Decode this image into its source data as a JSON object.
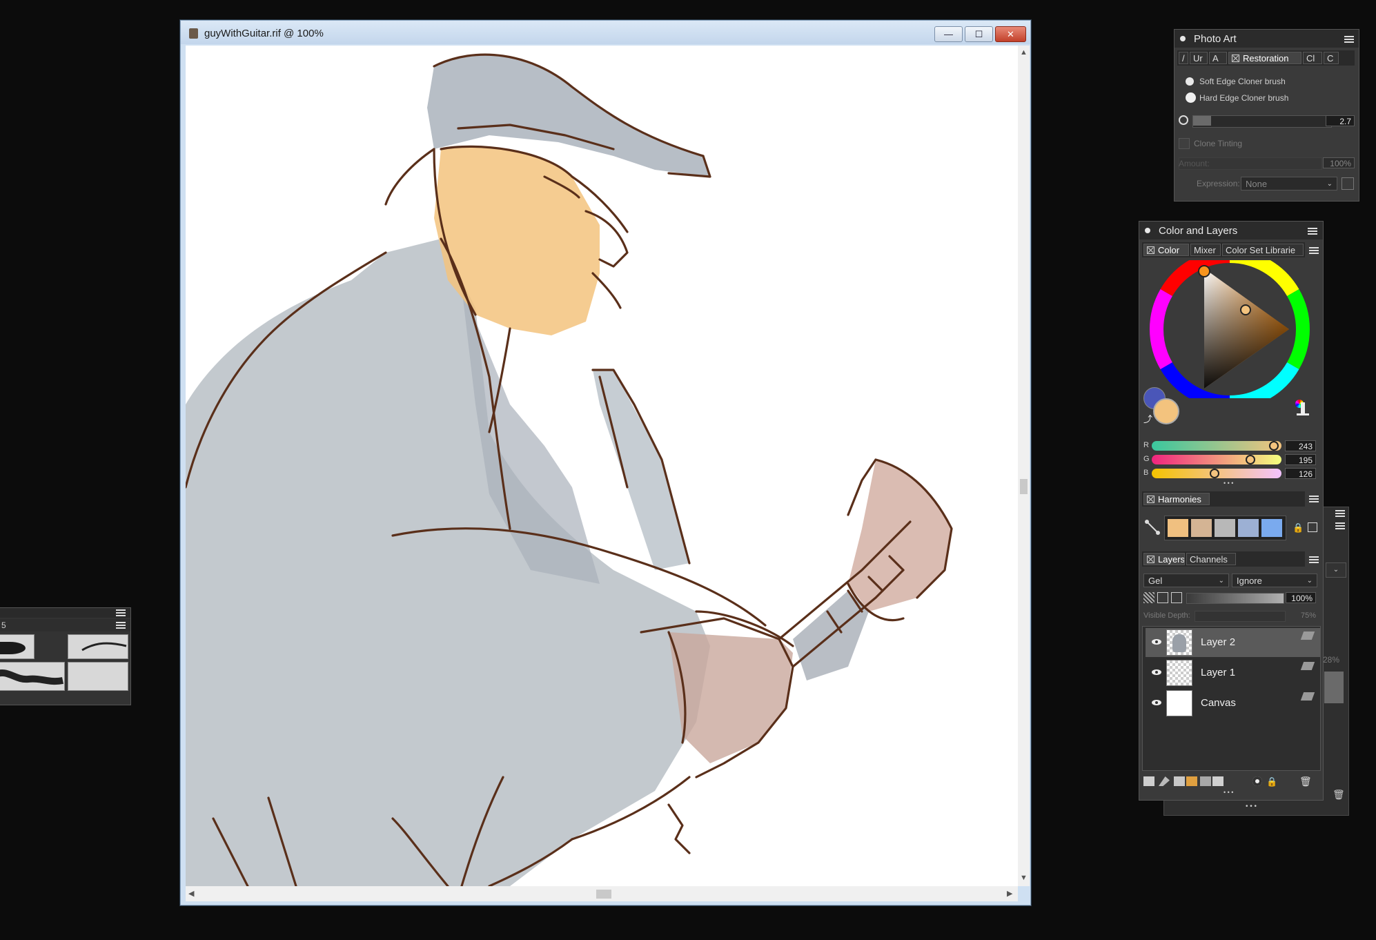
{
  "document": {
    "title": "guyWithGuitar.rif @ 100%",
    "minimize": "—",
    "maximize": "☐",
    "close": "✕"
  },
  "photo_art": {
    "title": "Photo Art",
    "tabs": [
      "/",
      "Ur",
      "A",
      "Restoration",
      "Cl",
      "C"
    ],
    "brushes": [
      "Soft Edge Cloner brush",
      "Hard Edge Cloner brush"
    ],
    "size_value": "2.7",
    "clone_tinting_label": "Clone Tinting",
    "amount_label": "Amount:",
    "amount_value": "100%",
    "expression_label": "Expression:",
    "expression_value": "None"
  },
  "color_layers": {
    "title": "Color and Layers",
    "color_tabs": [
      "Color",
      "Mixer",
      "Color Set Librarie"
    ],
    "rgb": {
      "r_label": "R",
      "r_value": "243",
      "g_label": "G",
      "g_value": "195",
      "b_label": "B",
      "b_value": "126"
    },
    "main_color": "#f3c37e",
    "secondary_color": "#4a56b8",
    "harmonies_label": "Harmonies",
    "harmony_swatches": [
      "#f0c080",
      "#d4b494",
      "#b8b8b8",
      "#9cb0d4",
      "#7aaaee"
    ],
    "layers_tabs": [
      "Layers",
      "Channels"
    ],
    "composite_method": "Gel",
    "composite_depth": "Ignore",
    "opacity_value": "100%",
    "visible_depth_label": "Visible Depth:",
    "visible_depth_value": "75%",
    "layers": [
      {
        "name": "Layer 2",
        "selected": true
      },
      {
        "name": "Layer 1",
        "selected": false
      },
      {
        "name": "Canvas",
        "selected": false
      }
    ],
    "more_dots": "• • •"
  },
  "behind_panel": {
    "percent_value": "28%"
  },
  "brush_panel": {
    "label": "5"
  }
}
